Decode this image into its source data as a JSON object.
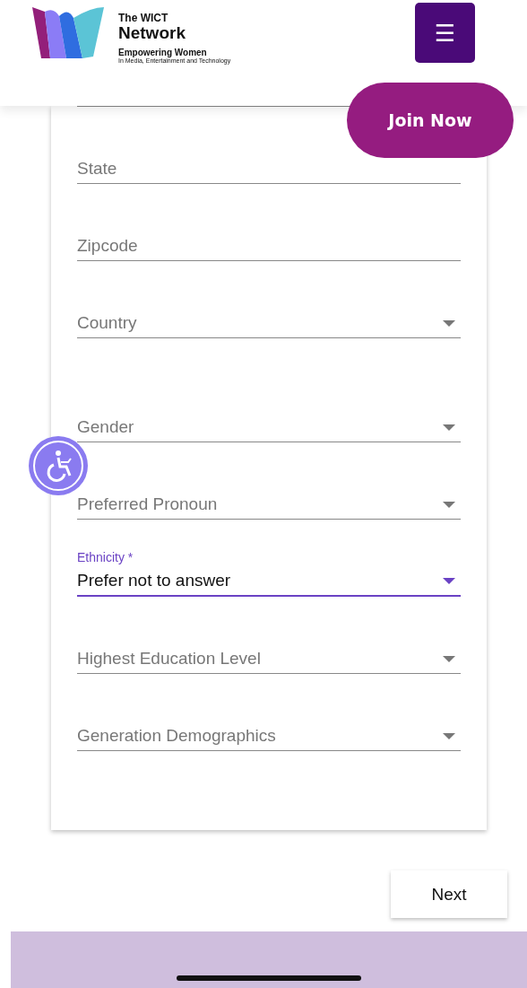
{
  "header": {
    "logo": {
      "line_1": "The WICT",
      "line_2": "Network",
      "tagline": "Empowering Women",
      "subtagline": "In Media, Entertainment and Technology"
    },
    "menu_button": "☰"
  },
  "join_button": "Join Now",
  "form": {
    "groups": [
      [
        {
          "kind": "text",
          "label": "State",
          "focused": false
        },
        {
          "kind": "text",
          "label": "Zipcode",
          "focused": false
        },
        {
          "kind": "select",
          "label": "Country",
          "focused": false
        }
      ],
      [
        {
          "kind": "select",
          "label": "Gender",
          "focused": false
        },
        {
          "kind": "select",
          "label": "Preferred Pronoun",
          "focused": false
        },
        {
          "kind": "select",
          "label": "Ethnicity *",
          "value": "Prefer not to answer",
          "focused": true
        },
        {
          "kind": "select",
          "label": "Highest Education Level",
          "focused": false
        },
        {
          "kind": "select",
          "label": "Generation Demographics",
          "focused": false
        }
      ]
    ]
  },
  "next_button": "Next"
}
